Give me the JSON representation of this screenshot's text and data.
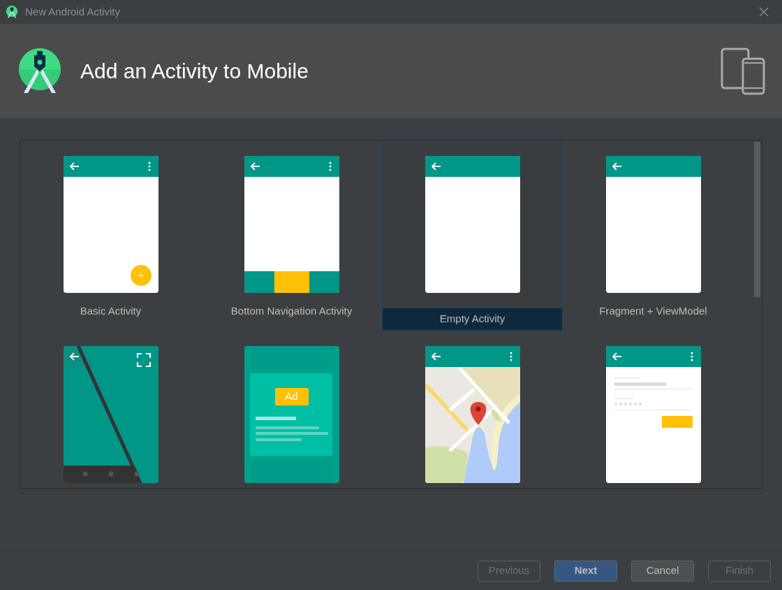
{
  "window": {
    "title": "New Android Activity"
  },
  "header": {
    "title": "Add an Activity to Mobile"
  },
  "templates": [
    {
      "kind": "basic",
      "label": "Basic Activity",
      "selected": false
    },
    {
      "kind": "bottom-nav",
      "label": "Bottom Navigation Activity",
      "selected": false
    },
    {
      "kind": "empty",
      "label": "Empty Activity",
      "selected": true
    },
    {
      "kind": "fragment",
      "label": "Fragment + ViewModel",
      "selected": false
    },
    {
      "kind": "fullscreen",
      "selected": false
    },
    {
      "kind": "ad",
      "ad_label": "Ad",
      "selected": false
    },
    {
      "kind": "map",
      "selected": false
    },
    {
      "kind": "login",
      "selected": false
    }
  ],
  "buttons": [
    {
      "label": "Previous",
      "disabled": true,
      "default": false
    },
    {
      "label": "Next",
      "disabled": false,
      "default": true
    },
    {
      "label": "Cancel",
      "disabled": false,
      "default": false
    },
    {
      "label": "Finish",
      "disabled": true,
      "default": false
    }
  ]
}
